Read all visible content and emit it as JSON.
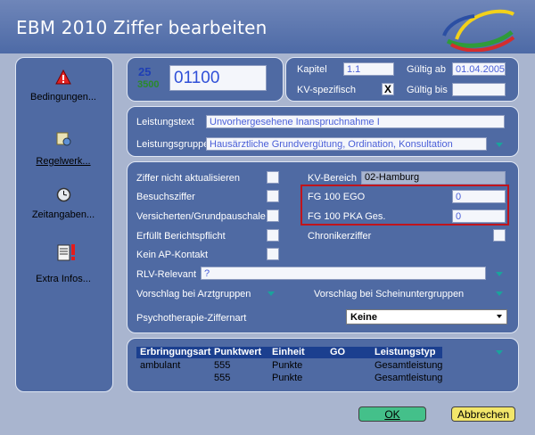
{
  "window": {
    "title": "EBM 2010 Ziffer bearbeiten"
  },
  "sidebar": {
    "items": [
      {
        "label": "Bedingungen...",
        "icon": "warning-icon"
      },
      {
        "label": "Regelwerk...",
        "icon": "rules-icon"
      },
      {
        "label": "Zeitangaben...",
        "icon": "clock-icon"
      },
      {
        "label": "Extra Infos...",
        "icon": "notes-icon"
      }
    ]
  },
  "header": {
    "icon_top": "25",
    "icon_bottom": "3500",
    "code": "01100",
    "kapitel_label": "Kapitel",
    "kapitel_value": "1.1",
    "gueltig_ab_label": "Gültig ab",
    "gueltig_ab_value": "01.04.2005",
    "kv_spezifisch_label": "KV-spezifisch",
    "kv_spezifisch_value": "X",
    "gueltig_bis_label": "Gültig bis",
    "gueltig_bis_value": ""
  },
  "leistung": {
    "text_label": "Leistungstext",
    "text_value": "Unvorhergesehene Inanspruchnahme I",
    "gruppe_label": "Leistungsgruppe",
    "gruppe_value": "Hausärztliche Grundvergütung, Ordination, Konsultation"
  },
  "flags": {
    "ziffer_nicht_aktualisieren": "Ziffer nicht aktualisieren",
    "besuchsziffer": "Besuchsziffer",
    "versicherten_grundpauschale": "Versicherten/Grundpauschale",
    "erfuellt_berichtspflicht": "Erfüllt Berichtspflicht",
    "kein_ap_kontakt": "Kein AP-Kontakt",
    "kv_bereich_label": "KV-Bereich",
    "kv_bereich_value": "02-Hamburg",
    "fg100_ego_label": "FG 100 EGO",
    "fg100_ego_value": "0",
    "fg100_pka_label": "FG 100 PKA Ges.",
    "fg100_pka_value": "0",
    "chronikerziffer": "Chronikerziffer",
    "rlv_label": "RLV-Relevant",
    "rlv_value": "?",
    "vorschlag_arzt": "Vorschlag bei Arztgruppen",
    "vorschlag_schein": "Vorschlag bei Scheinuntergruppen",
    "psycho_label": "Psychotherapie-Ziffernart",
    "psycho_value": "Keine"
  },
  "table": {
    "headers": [
      "Erbringungsart",
      "Punktwert",
      "Einheit",
      "GO",
      "Leistungstyp"
    ],
    "rows": [
      [
        "ambulant",
        "555",
        "Punkte",
        "",
        "Gesamtleistung"
      ],
      [
        "",
        "555",
        "Punkte",
        "",
        "Gesamtleistung"
      ]
    ]
  },
  "buttons": {
    "ok": "OK",
    "cancel": "Abbrechen"
  },
  "colors": {
    "accent_teal": "#1aa39c",
    "highlight_red": "#c0141c",
    "ok_green": "#44c08a",
    "cancel_yellow": "#f2e66a"
  }
}
